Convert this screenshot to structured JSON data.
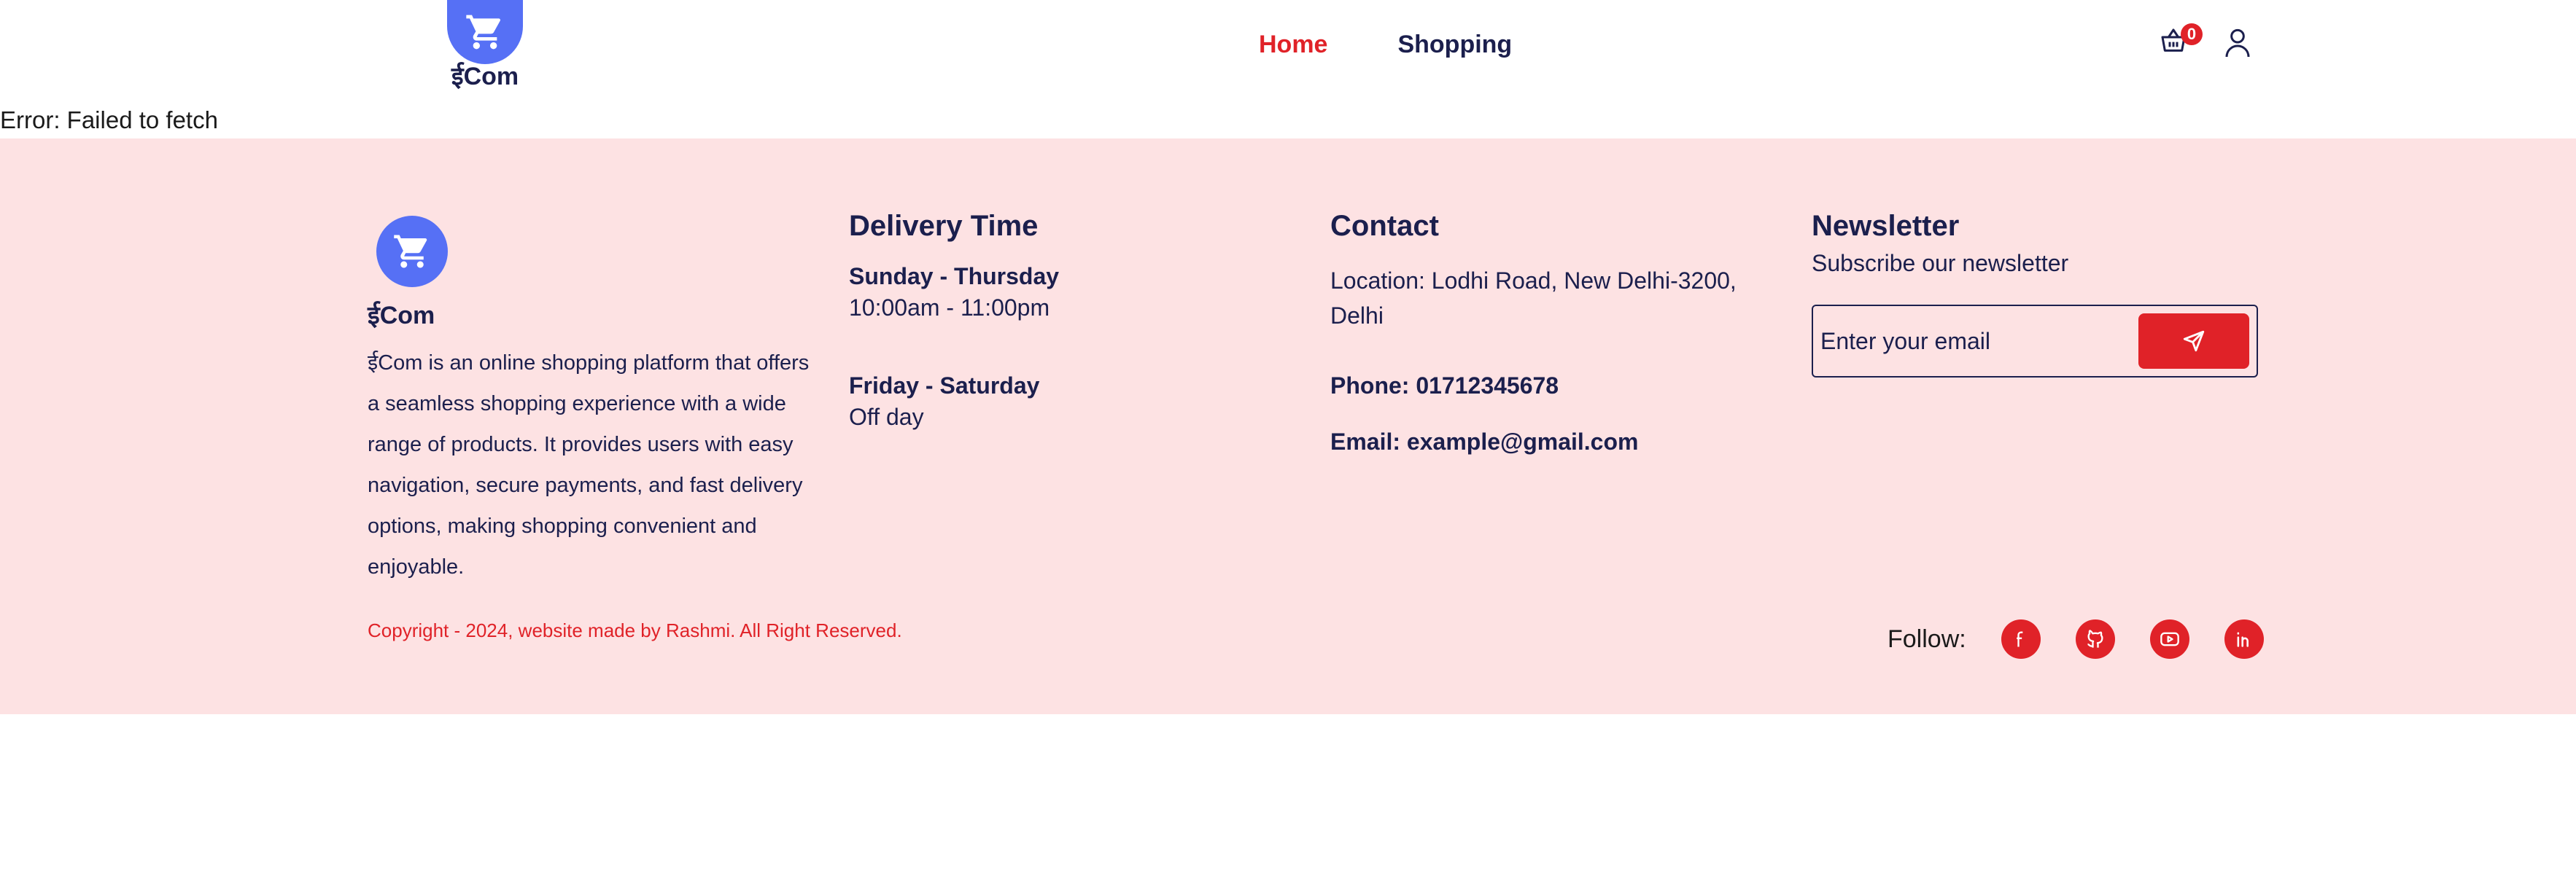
{
  "header": {
    "logo_text": "ईCom",
    "nav": [
      {
        "label": "Home",
        "active": true
      },
      {
        "label": "Shopping",
        "active": false
      }
    ],
    "cart_count": "0",
    "cart_icon": "basket-icon",
    "user_icon": "user-icon"
  },
  "error_message": "Error: Failed to fetch",
  "footer": {
    "brand": {
      "logo_text": "ईCom",
      "description": "ईCom is an online shopping platform that offers a seamless shopping experience with a wide range of products. It provides users with easy navigation, secure payments, and fast delivery options, making shopping convenient and enjoyable."
    },
    "delivery": {
      "title": "Delivery Time",
      "slots": [
        {
          "days": "Sunday - Thursday",
          "hours": "10:00am - 11:00pm"
        },
        {
          "days": "Friday - Saturday",
          "hours": "Off day"
        }
      ]
    },
    "contact": {
      "title": "Contact",
      "location": "Location: Lodhi Road, New Delhi-3200, Delhi",
      "phone": "Phone: 01712345678",
      "email": "Email: example@gmail.com"
    },
    "newsletter": {
      "title": "Newsletter",
      "subtitle": "Subscribe our newsletter",
      "placeholder": "Enter your email",
      "send_icon": "send-icon"
    },
    "copyright": "Copyright - 2024, website made by Rashmi. All Right Reserved.",
    "follow_label": "Follow:",
    "socials": [
      "facebook-icon",
      "github-icon",
      "youtube-icon",
      "linkedin-icon"
    ]
  },
  "colors": {
    "accent": "#e02228",
    "brand_blue": "#5670f5",
    "footer_bg": "#fde2e3",
    "text_dark": "#1b1f4d"
  }
}
